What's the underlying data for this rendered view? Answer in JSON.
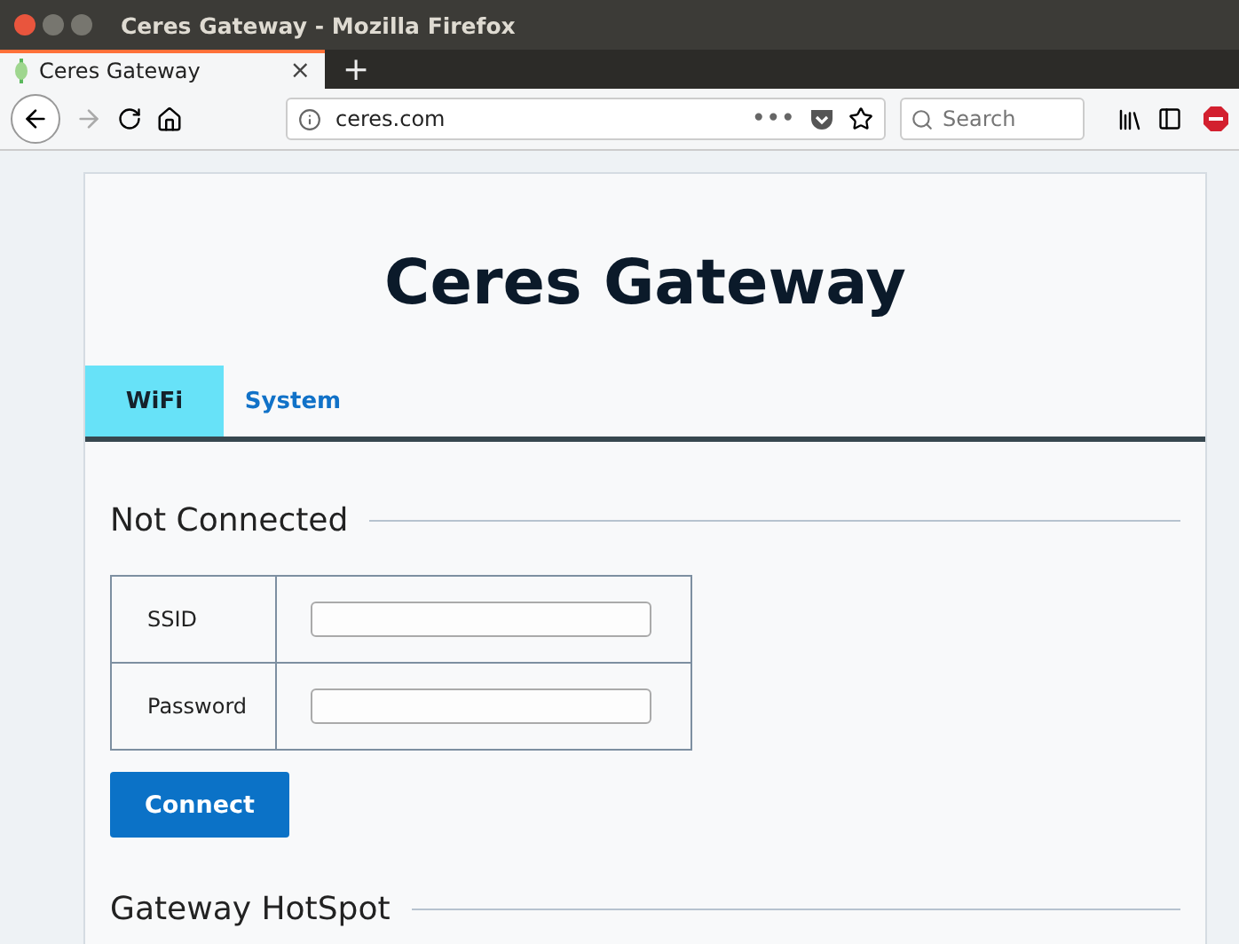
{
  "window": {
    "title": "Ceres Gateway - Mozilla Firefox"
  },
  "browser_tab": {
    "title": "Ceres Gateway",
    "close": "×",
    "new_tab": "+"
  },
  "address_bar": {
    "url": "ceres.com",
    "more": "•••"
  },
  "search": {
    "placeholder": "Search"
  },
  "page": {
    "heading": "Ceres Gateway",
    "tabs": [
      {
        "label": "WiFi",
        "selected": true
      },
      {
        "label": "System",
        "selected": false
      }
    ],
    "sections": [
      {
        "title": "Not Connected",
        "fields": [
          {
            "label": "SSID"
          },
          {
            "label": "Password"
          }
        ],
        "button": "Connect"
      },
      {
        "title": "Gateway HotSpot"
      }
    ]
  }
}
